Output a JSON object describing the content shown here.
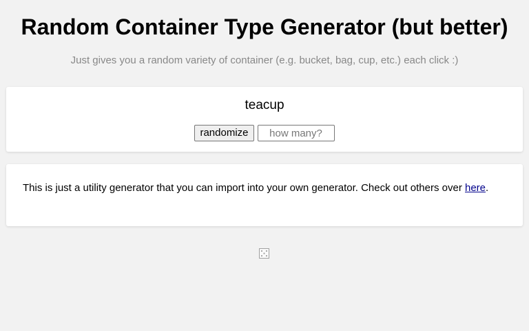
{
  "header": {
    "title": "Random Container Type Generator (but better)",
    "subtitle": "Just gives you a random variety of container (e.g. bucket, bag, cup, etc.) each click :)"
  },
  "generator": {
    "output": "teacup",
    "randomize_label": "randomize",
    "count_placeholder": "how many?",
    "count_value": ""
  },
  "info": {
    "text_before_link": "This is just a utility generator that you can import into your own generator. Check out others over ",
    "link_label": "here",
    "text_after_link": "."
  },
  "footer": {
    "icon": "dice-icon"
  },
  "colors": {
    "background": "#f2f2f2",
    "card": "#ffffff",
    "subtitle": "#888888",
    "link": "#00008b"
  }
}
